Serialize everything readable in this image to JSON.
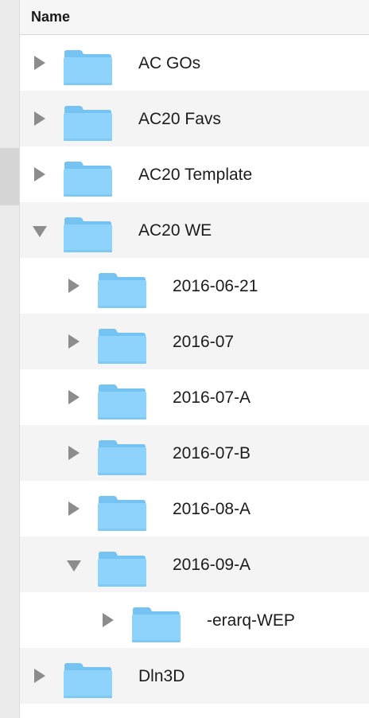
{
  "header": {
    "column_name": "Name"
  },
  "colors": {
    "folder_fill": "#8ed3fb",
    "folder_tab": "#74c3f2",
    "disclosure": "#8c8c8c",
    "alt_row": "#f4f4f4"
  },
  "icons": {
    "folder": "folder-icon",
    "disclosure_collapsed": "disclosure-triangle-right",
    "disclosure_expanded": "disclosure-triangle-down"
  },
  "rows": [
    {
      "label": "AC GOs",
      "level": 0,
      "expanded": false
    },
    {
      "label": "AC20 Favs",
      "level": 0,
      "expanded": false
    },
    {
      "label": "AC20 Template",
      "level": 0,
      "expanded": false
    },
    {
      "label": "AC20 WE",
      "level": 0,
      "expanded": true
    },
    {
      "label": "2016-06-21",
      "level": 1,
      "expanded": false
    },
    {
      "label": "2016-07",
      "level": 1,
      "expanded": false
    },
    {
      "label": "2016-07-A",
      "level": 1,
      "expanded": false
    },
    {
      "label": "2016-07-B",
      "level": 1,
      "expanded": false
    },
    {
      "label": "2016-08-A",
      "level": 1,
      "expanded": false
    },
    {
      "label": "2016-09-A",
      "level": 1,
      "expanded": true
    },
    {
      "label": "-erarq-WEP",
      "level": 2,
      "expanded": false
    },
    {
      "label": "Dln3D",
      "level": 0,
      "expanded": false
    }
  ]
}
